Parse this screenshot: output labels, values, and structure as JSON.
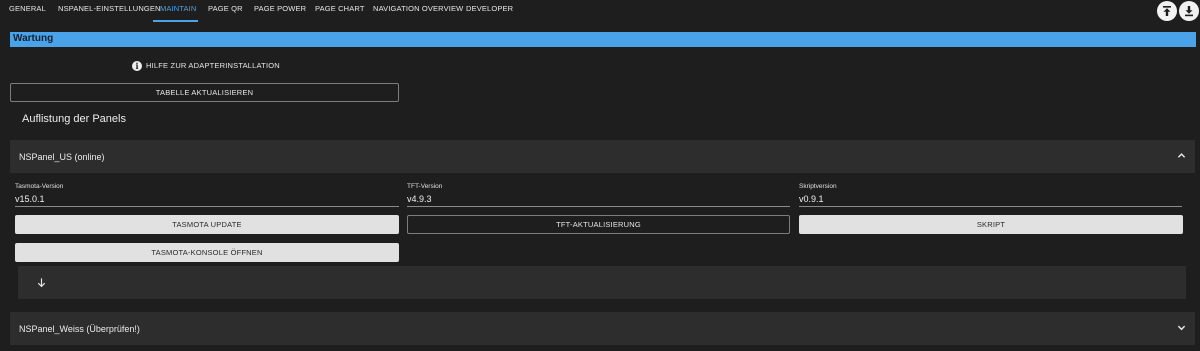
{
  "tabs": [
    {
      "label": "GENERAL"
    },
    {
      "label": "NSPANEL-EINSTELLUNGEN"
    },
    {
      "label": "MAINTAIN"
    },
    {
      "label": "PAGE QR"
    },
    {
      "label": "PAGE POWER"
    },
    {
      "label": "PAGE CHART"
    },
    {
      "label": "NAVIGATION OVERVIEW"
    },
    {
      "label": "DEVELOPER"
    }
  ],
  "active_tab": "MAINTAIN",
  "header_icons": [
    "upload-icon",
    "download-icon"
  ],
  "section_title": "Wartung",
  "help": {
    "label": "HILFE ZUR ADAPTERINSTALLATION",
    "icon": "info-icon"
  },
  "refresh_button": "TABELLE AKTUALISIEREN",
  "panels_heading": "Auflistung der Panels",
  "panels": [
    {
      "title": "NSPanel_US (online)",
      "expanded": true,
      "tasmota": {
        "label": "Tasmota-Version",
        "value": "v15.0.1"
      },
      "tft": {
        "label": "TFT-Version",
        "value": "v4.9.3"
      },
      "script": {
        "label": "Skriptversion",
        "value": "v0.9.1"
      },
      "buttons": {
        "tasmota_update": "TASMOTA UPDATE",
        "tft_update": "TFT-AKTUALISIERUNG",
        "script": "SKRIPT",
        "tasmota_console": "TASMOTA-KONSOLE ÖFFNEN"
      }
    },
    {
      "title": "NSPanel_Weiss (Überprüfen!)",
      "expanded": false
    }
  ],
  "colors": {
    "accent": "#4aa3e8",
    "background": "#1e1e1e",
    "panel": "#2d2d2d",
    "button": "#e1e1e1"
  }
}
